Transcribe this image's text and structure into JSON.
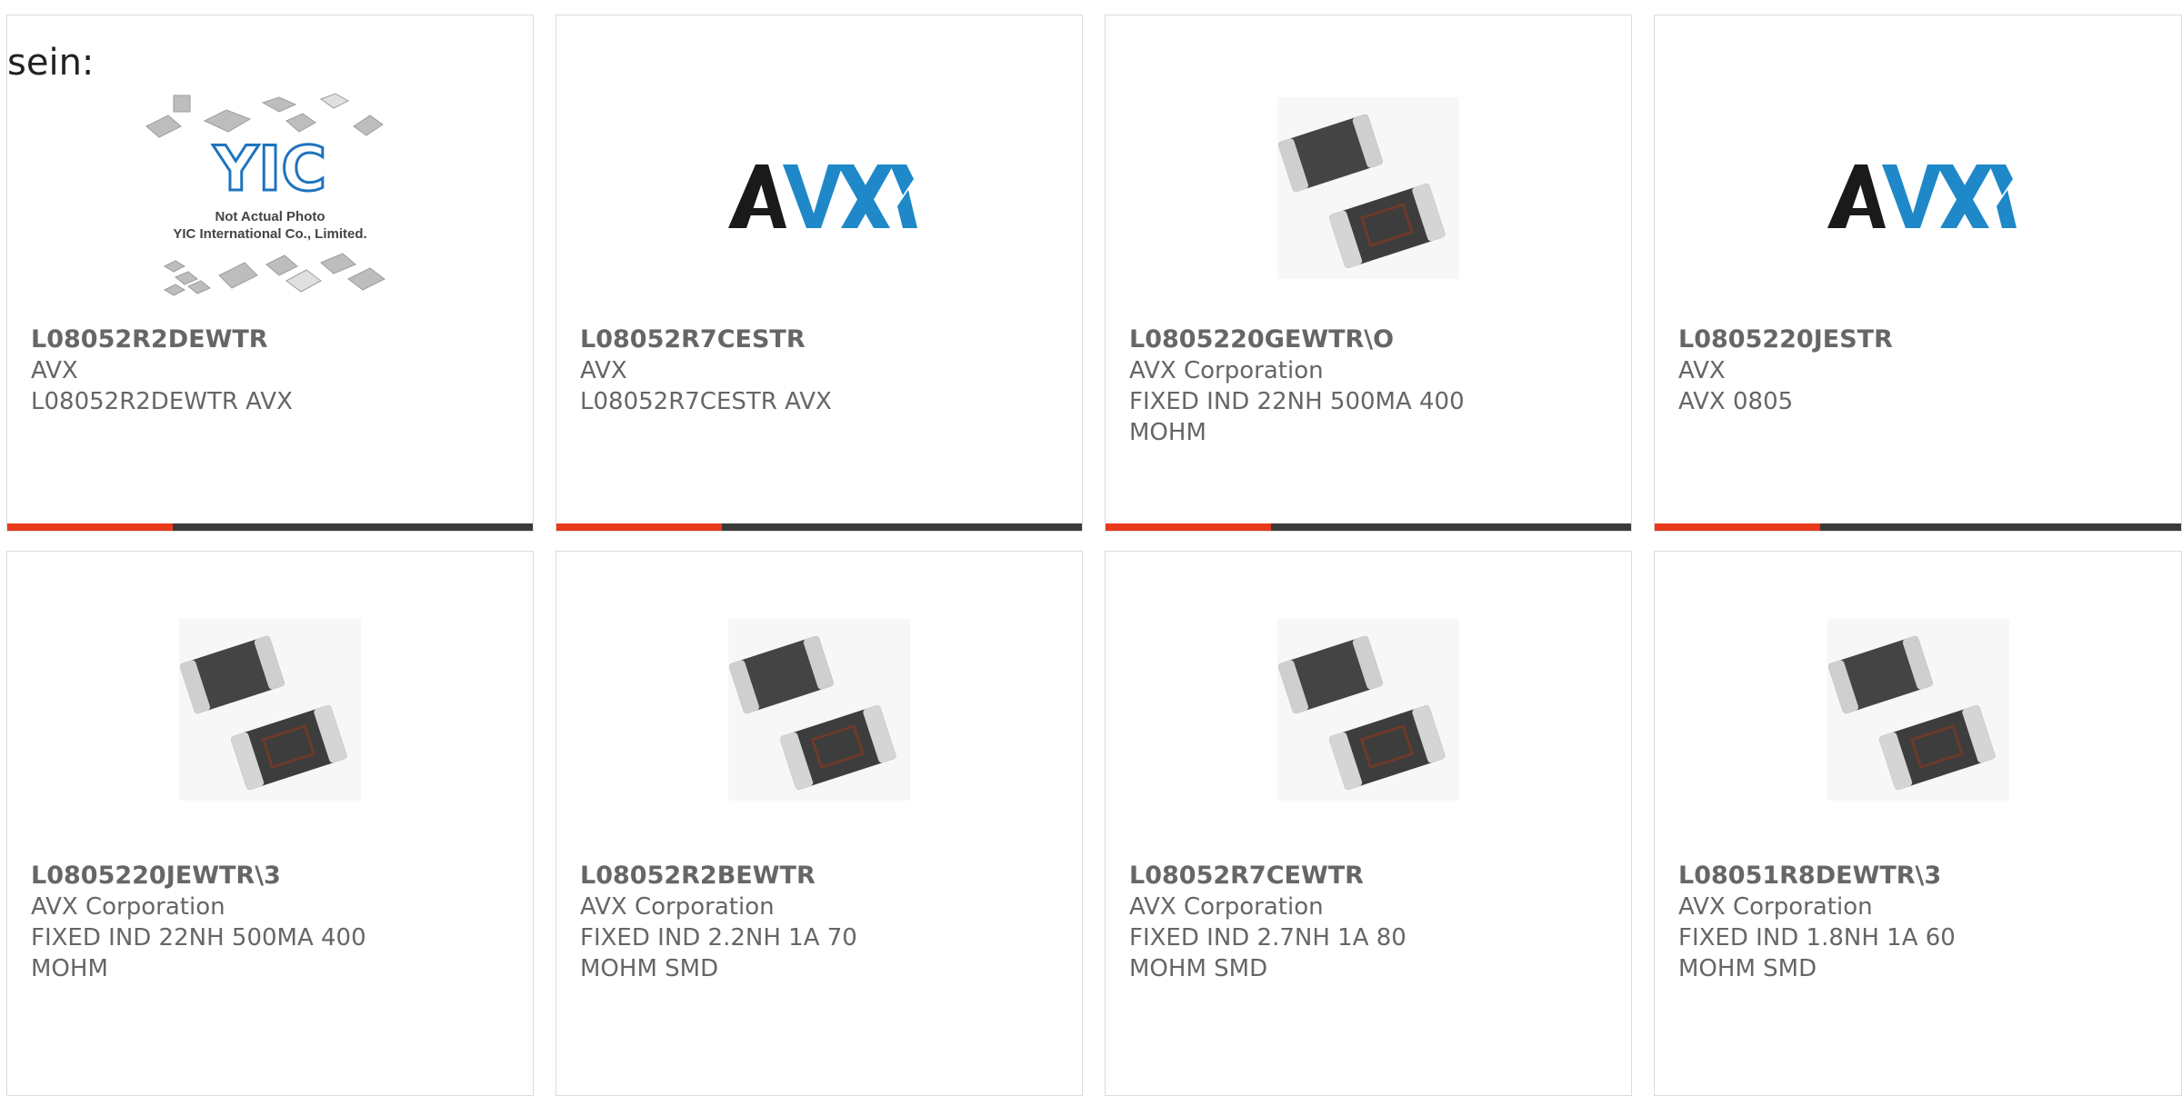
{
  "prefix_text": "sein:",
  "colors": {
    "accent": "#e8391b",
    "bar": "#3a3a3a",
    "text": "#666666",
    "avx_dark": "#1a1a1a",
    "avx_blue": "#1e88c8"
  },
  "products": [
    {
      "part": "L08052R2DEWTR",
      "maker": "AVX",
      "desc": "L08052R2DEWTR AVX",
      "image": "not-actual-photo-placeholder"
    },
    {
      "part": "L08052R7CESTR",
      "maker": "AVX",
      "desc": "L08052R7CESTR AVX",
      "image": "avx-logo"
    },
    {
      "part": "L0805220GEWTR\\O",
      "maker": "AVX Corporation",
      "desc": "FIXED IND 22NH 500MA 400 MOHM",
      "image": "smd-inductor-photo"
    },
    {
      "part": "L0805220JESTR",
      "maker": "AVX",
      "desc": "AVX 0805",
      "image": "avx-logo"
    },
    {
      "part": "L0805220JEWTR\\3",
      "maker": "AVX Corporation",
      "desc": "FIXED IND 22NH 500MA 400 MOHM",
      "image": "smd-inductor-photo"
    },
    {
      "part": "L08052R2BEWTR",
      "maker": "AVX Corporation",
      "desc": "FIXED IND 2.2NH 1A 70 MOHM SMD",
      "image": "smd-inductor-photo"
    },
    {
      "part": "L08052R7CEWTR",
      "maker": "AVX Corporation",
      "desc": "FIXED IND 2.7NH 1A 80 MOHM SMD",
      "image": "smd-inductor-photo"
    },
    {
      "part": "L08051R8DEWTR\\3",
      "maker": "AVX Corporation",
      "desc": "FIXED IND 1.8NH 1A 60 MOHM SMD",
      "image": "smd-inductor-photo"
    }
  ],
  "placeholder": {
    "brand": "YIC",
    "line1": "Not Actual Photo",
    "line2": "YIC International Co., Limited."
  }
}
